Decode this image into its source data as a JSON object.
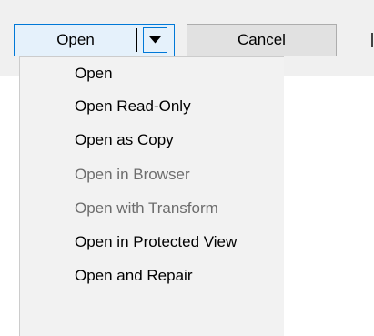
{
  "buttons": {
    "open_label": "Open",
    "cancel_label": "Cancel"
  },
  "menu": {
    "items": [
      {
        "label": "Open",
        "enabled": true
      },
      {
        "label": "Open Read-Only",
        "enabled": true
      },
      {
        "label": "Open as Copy",
        "enabled": true
      },
      {
        "label": "Open in Browser",
        "enabled": false
      },
      {
        "label": "Open with Transform",
        "enabled": false
      },
      {
        "label": "Open in Protected View",
        "enabled": true
      },
      {
        "label": "Open and Repair",
        "enabled": true
      }
    ]
  },
  "colors": {
    "accent_border": "#0078d7",
    "open_button_fill": "#e5f1fb",
    "cancel_button_fill": "#e1e1e1",
    "menu_background": "#f2f2f2",
    "disabled_text": "#6d6d6d"
  },
  "icons": {
    "split_arrow": "dropdown-arrow-icon"
  }
}
